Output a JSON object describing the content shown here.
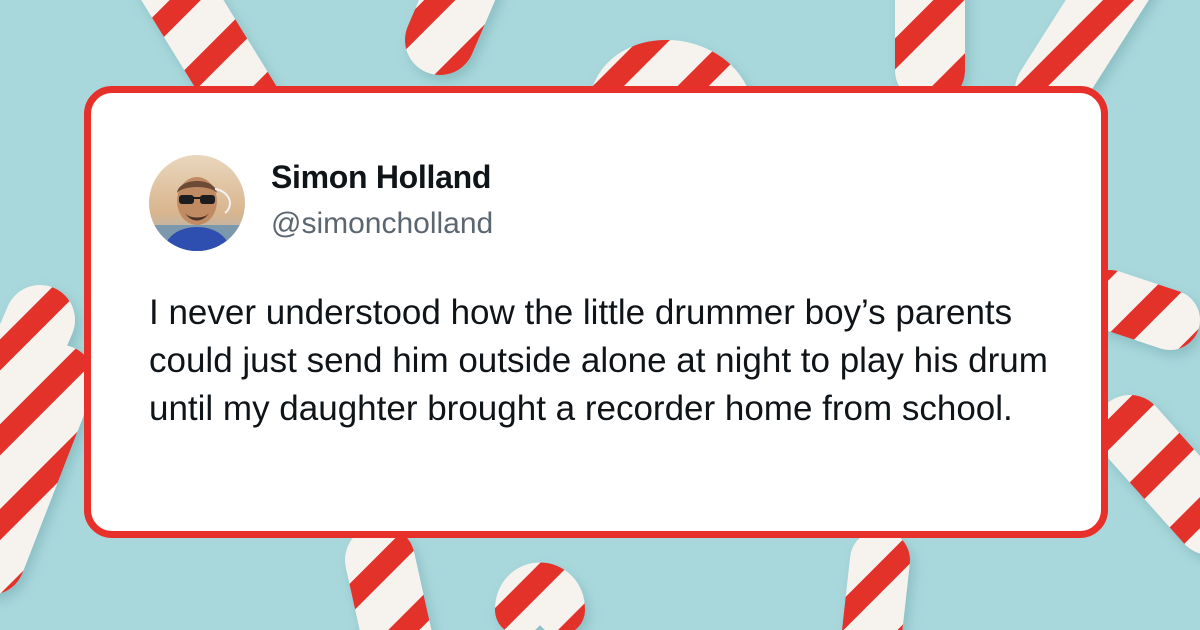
{
  "background": {
    "color": "#a9d8dc",
    "decoration": "candy-cane"
  },
  "tweet": {
    "author_name": "Simon Holland",
    "author_handle": "@simoncholland",
    "avatar_icon": "avatar-photo",
    "text": "I never understood how the little drummer boy’s parents could just send him outside alone at night to play his drum until my daughter brought a recorder home from school.",
    "border_color": "#e8302a"
  }
}
